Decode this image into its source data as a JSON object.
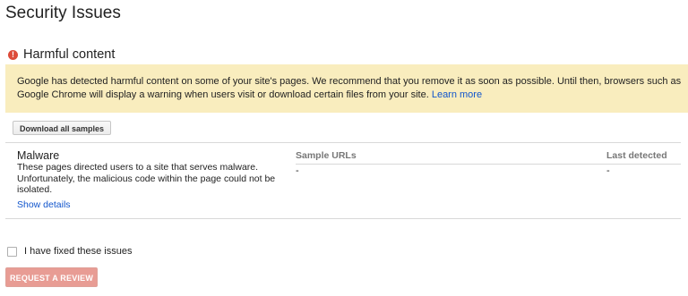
{
  "page": {
    "title": "Security Issues"
  },
  "section": {
    "icon": "exclamation-circle-icon",
    "title": "Harmful content"
  },
  "alert": {
    "text": "Google has detected harmful content on some of your site's pages. We recommend that you remove it as soon as possible. Until then, browsers such as Google Chrome will display a warning when users visit or download certain files from your site.",
    "link": "Learn more"
  },
  "buttons": {
    "download_all": "Download all samples",
    "request_review": "REQUEST A REVIEW"
  },
  "table": {
    "columns": [
      "Sample URLs",
      "Last detected"
    ],
    "row": {
      "title": "Malware",
      "description": "These pages directed users to a site that serves malware. Unfortunately, the malicious code within the page could not be isolated.",
      "show_details": "Show details",
      "sample_urls": "-",
      "last_detected": "-"
    }
  },
  "fixed": {
    "label": "I have fixed these issues",
    "checked": false
  },
  "colors": {
    "alert_bg": "#f9edbe",
    "link": "#1155cc",
    "warning_red": "#dd4b39",
    "review_button_disabled": "#e89c94"
  }
}
